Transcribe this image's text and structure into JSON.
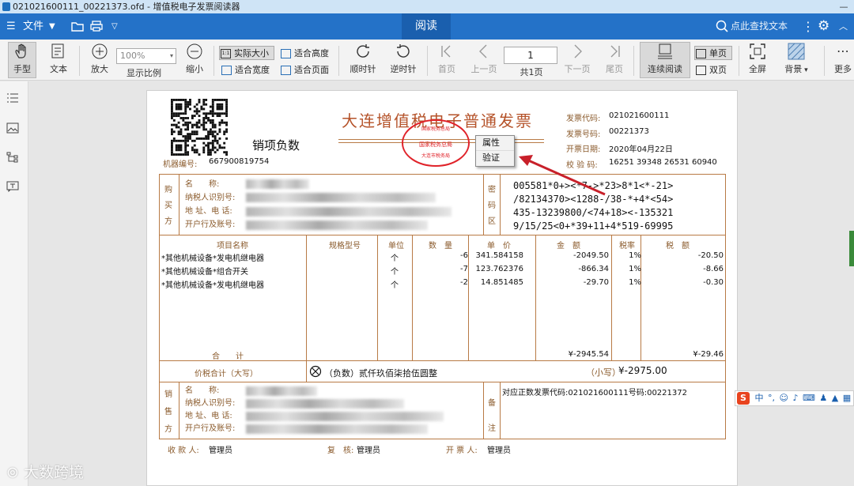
{
  "window": {
    "title": "021021600111_00221373.ofd - 增值税电子发票阅读器"
  },
  "menubar": {
    "file": "文件",
    "read_tab": "阅读",
    "search_placeholder": "点此查找文本"
  },
  "toolbar": {
    "hand": "手型",
    "text": "文本",
    "zoom_in": "放大",
    "zoom_level": "100%",
    "zoom_ratio": "显示比例",
    "zoom_out": "缩小",
    "actual_size": "实际大小",
    "fit_height": "适合高度",
    "fit_width": "适合宽度",
    "fit_page": "适合页面",
    "rotate_cw": "顺时针",
    "rotate_ccw": "逆时针",
    "first_page": "首页",
    "prev_page": "上一页",
    "page_input": "1",
    "page_total": "共1页",
    "next_page": "下一页",
    "last_page": "尾页",
    "continuous": "连续阅读",
    "single": "单页",
    "double": "双页",
    "fullscreen": "全屏",
    "background": "背景",
    "more": "更多"
  },
  "invoice": {
    "title": "大连增值税电子普通发票",
    "subtitle": "销项负数",
    "machine_no_label": "机器编号:",
    "machine_no": "667900819754",
    "code_label": "发票代码:",
    "code": "021021600111",
    "number_label": "发票号码:",
    "number": "00221373",
    "date_label": "开票日期:",
    "date": "2020年04月22日",
    "check_label": "校 验 码:",
    "check": "16251 39348 26531 60940",
    "buyer_side": [
      "购",
      "买",
      "方"
    ],
    "party_labels": [
      "名　　称:",
      "纳税人识别号:",
      "地 址、电 话:",
      "开户行及账号:"
    ],
    "cipher_side": [
      "密",
      "码",
      "区"
    ],
    "cipher": [
      "005581*0+><*7->*23>8*1<*-21>",
      "/82134370><1288-/38-*+4*<54>",
      "435-13239800/<74+18><-135321",
      "9/15/25<0+*39+11+4*519-69995"
    ],
    "columns": [
      "项目名称",
      "规格型号",
      "单位",
      "数　量",
      "单　价",
      "金　额",
      "税率",
      "税　额"
    ],
    "items": [
      {
        "name": "*其他机械设备*发电机继电器",
        "unit": "个",
        "qty": "-6",
        "price": "341.584158",
        "amount": "-2049.50",
        "rate": "1%",
        "tax": "-20.50"
      },
      {
        "name": "*其他机械设备*组合开关",
        "unit": "个",
        "qty": "-7",
        "price": "123.762376",
        "amount": "-866.34",
        "rate": "1%",
        "tax": "-8.66"
      },
      {
        "name": "*其他机械设备*发电机继电器",
        "unit": "个",
        "qty": "-2",
        "price": "14.851485",
        "amount": "-29.70",
        "rate": "1%",
        "tax": "-0.30"
      }
    ],
    "total_label": "合　　计",
    "total_amount": "¥-2945.54",
    "total_tax": "¥-29.46",
    "price_tax_label": "价税合计（大写）",
    "price_tax_words": "（负数）贰仟玖佰柒拾伍圆整",
    "small_label": "（小写）",
    "small_value": "¥-2975.00",
    "seller_side": [
      "销",
      "售",
      "方"
    ],
    "remark_side": [
      "备",
      "注"
    ],
    "remark": "对应正数发票代码:021021600111号码:00221372",
    "payee_label": "收 款 人:",
    "payee": "管理员",
    "reviewer_label": "复　核:",
    "reviewer": "管理员",
    "issuer_label": "开 票 人:",
    "issuer": "管理员",
    "seal_top": "国家税务总局",
    "seal_mid": "国家税务总局",
    "seal_bottom": "大连市税务局"
  },
  "context_menu": {
    "items": [
      "属性",
      "验证"
    ]
  },
  "ime": {
    "label": "中"
  },
  "watermark": {
    "text": "大数跨境"
  },
  "colors": {
    "accent": "#2472c8",
    "invoice_line": "#b87a45",
    "seal": "#e0232a",
    "arrow": "#c8202a"
  }
}
